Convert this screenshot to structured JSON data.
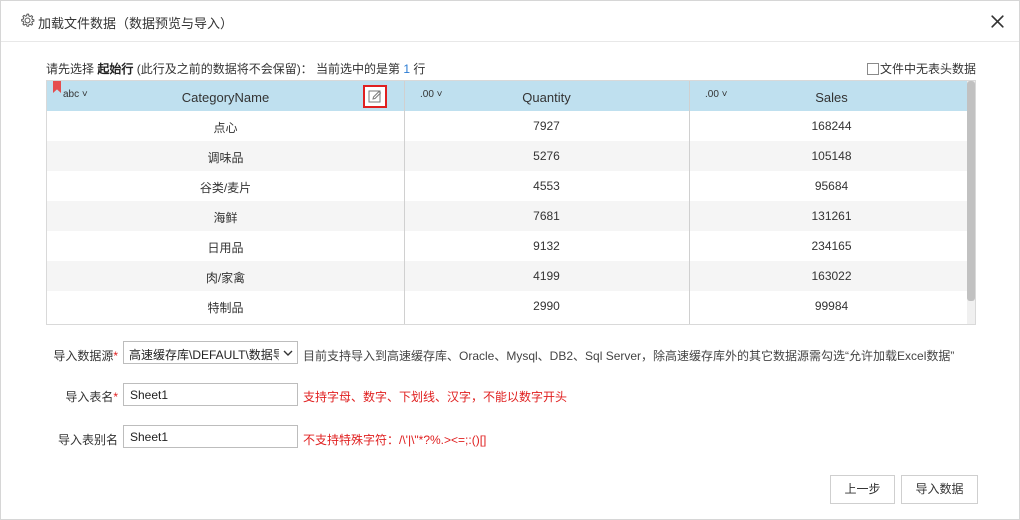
{
  "dialog": {
    "title": "加载文件数据（数据预览与导入）",
    "title_icon": "gear-icon",
    "close_icon": "close-icon"
  },
  "hint": {
    "prefix": "请先选择 ",
    "bold": "起始行",
    "middle": " (此行及之前的数据将不会保留)：  当前选中的是第 ",
    "row_number": "1",
    "suffix": " 行",
    "no_header_label": "文件中无表头数据"
  },
  "grid": {
    "columns": [
      {
        "type": "abc",
        "name": "CategoryName"
      },
      {
        "type": ".00",
        "name": "Quantity"
      },
      {
        "type": ".00",
        "name": "Sales"
      }
    ],
    "rows": [
      [
        "点心",
        "7927",
        "168244"
      ],
      [
        "调味品",
        "5276",
        "105148"
      ],
      [
        "谷类/麦片",
        "4553",
        "95684"
      ],
      [
        "海鲜",
        "7681",
        "131261"
      ],
      [
        "日用品",
        "9132",
        "234165"
      ],
      [
        "肉/家禽",
        "4199",
        "163022"
      ],
      [
        "特制品",
        "2990",
        "99984"
      ]
    ]
  },
  "form": {
    "source_label": "导入数据源",
    "source_value": "高速缓存库\\DEFAULT\\数据导",
    "source_note": "目前支持导入到高速缓存库、Oracle、Mysql、DB2、Sql Server，除高速缓存库外的其它数据源需勾选“允许加载Excel数据”",
    "table_label": "导入表名",
    "table_value": "Sheet1",
    "table_note": "支持字母、数字、下划线、汉字，不能以数字开头",
    "alias_label": "导入表别名",
    "alias_value": "Sheet1",
    "alias_note": "不支持特殊字符：/\\'|\\\"*?%.><=;:()[]",
    "required_mark": "*"
  },
  "buttons": {
    "prev": "上一步",
    "import": "导入数据"
  },
  "colors": {
    "header_bg": "#bfe0ef",
    "accent_red": "#e02020",
    "link_blue": "#2a7bd3"
  }
}
